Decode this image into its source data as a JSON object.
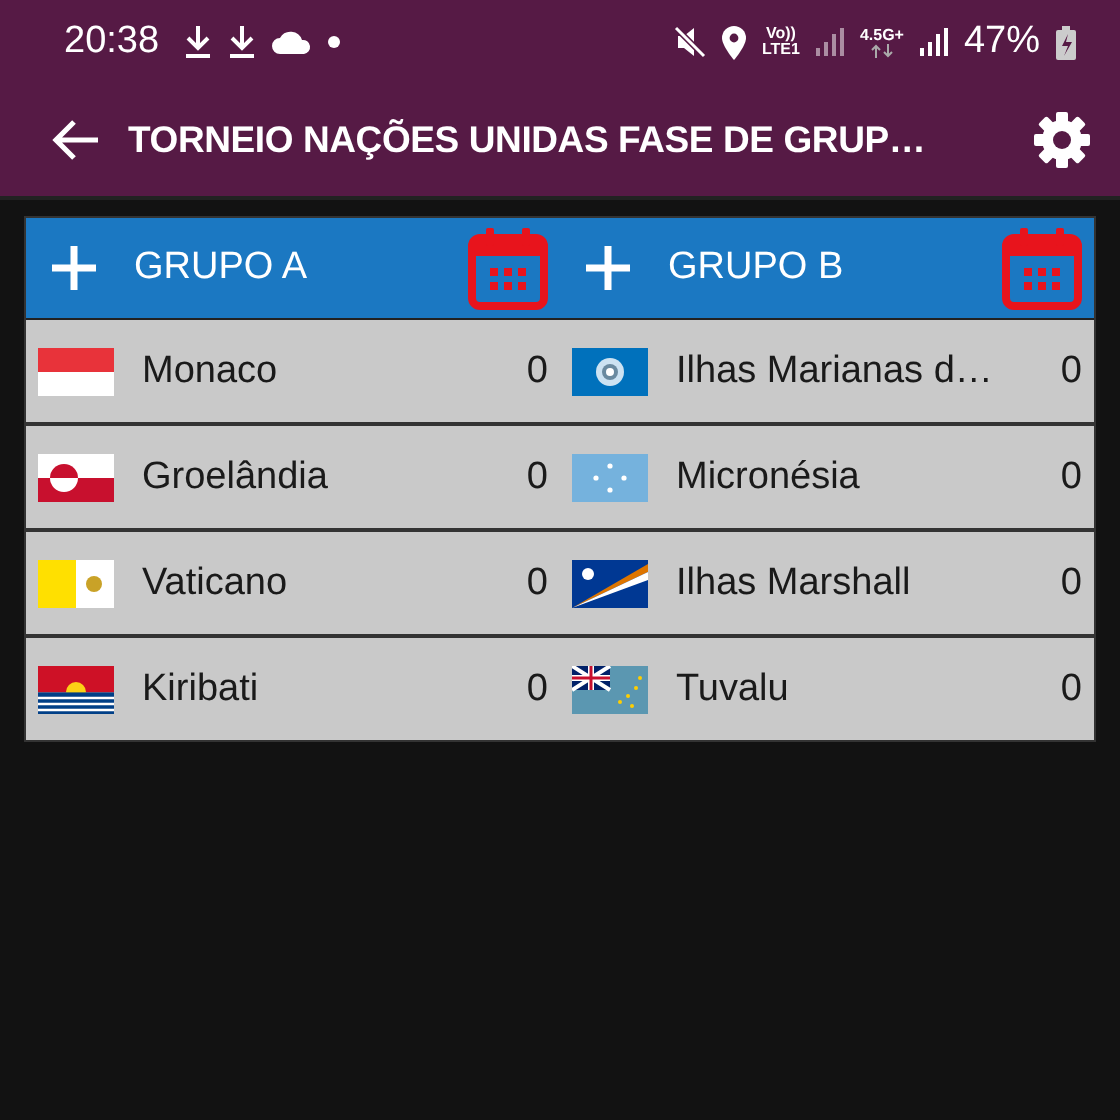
{
  "status_bar": {
    "time": "20:38",
    "volte": "Vo))",
    "lte": "LTE1",
    "network": "4.5G+",
    "battery": "47%"
  },
  "app_bar": {
    "title": "TORNEIO NAÇÕES UNIDAS FASE DE GRUP…"
  },
  "groups": [
    {
      "title": "GRUPO A",
      "teams": [
        {
          "name": "Monaco",
          "points": "0"
        },
        {
          "name": "Groelândia",
          "points": "0"
        },
        {
          "name": "Vaticano",
          "points": "0"
        },
        {
          "name": "Kiribati",
          "points": "0"
        }
      ]
    },
    {
      "title": "GRUPO B",
      "teams": [
        {
          "name": "Ilhas Marianas d…",
          "points": "0"
        },
        {
          "name": "Micronésia",
          "points": "0"
        },
        {
          "name": "Ilhas Marshall",
          "points": "0"
        },
        {
          "name": "Tuvalu",
          "points": "0"
        }
      ]
    }
  ]
}
